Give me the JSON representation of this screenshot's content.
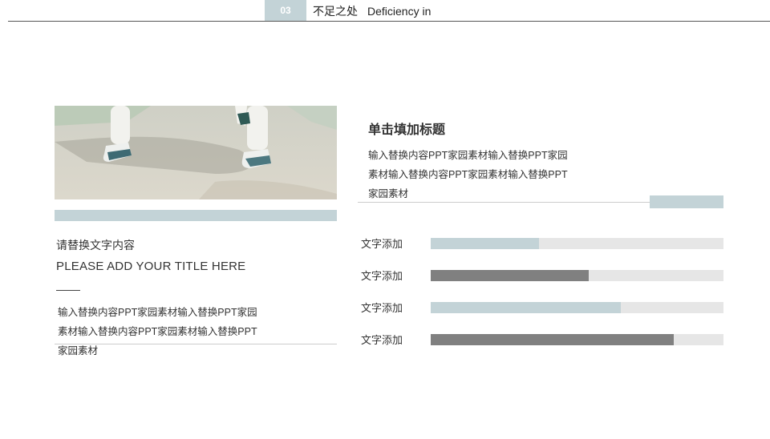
{
  "header": {
    "section_number": "03",
    "title_cn": "不足之处",
    "title_en": "Deficiency in"
  },
  "left_panel": {
    "heading": "请替换文字内容",
    "title": "PLEASE ADD YOUR TITLE HERE",
    "body": [
      "输入替换内容PPT家园素材输入替换PPT家园",
      "素材输入替换内容PPT家园素材输入替换PPT",
      "家园素材"
    ]
  },
  "right_panel": {
    "heading": "单击填加标题",
    "body": [
      "输入替换内容PPT家园素材输入替换PPT家园",
      "素材输入替换内容PPT家园素材输入替换PPT",
      "家园素材"
    ]
  },
  "progress_bars": [
    {
      "label": "文字添加",
      "value": 0.37,
      "color": "#c3d3d7"
    },
    {
      "label": "文字添加",
      "value": 0.54,
      "color": "#808080"
    },
    {
      "label": "文字添加",
      "value": 0.65,
      "color": "#c3d3d7"
    },
    {
      "label": "文字添加",
      "value": 0.83,
      "color": "#808080"
    }
  ],
  "colors": {
    "accent": "#c3d3d7",
    "dark_bar": "#808080",
    "track": "#e6e6e6"
  }
}
